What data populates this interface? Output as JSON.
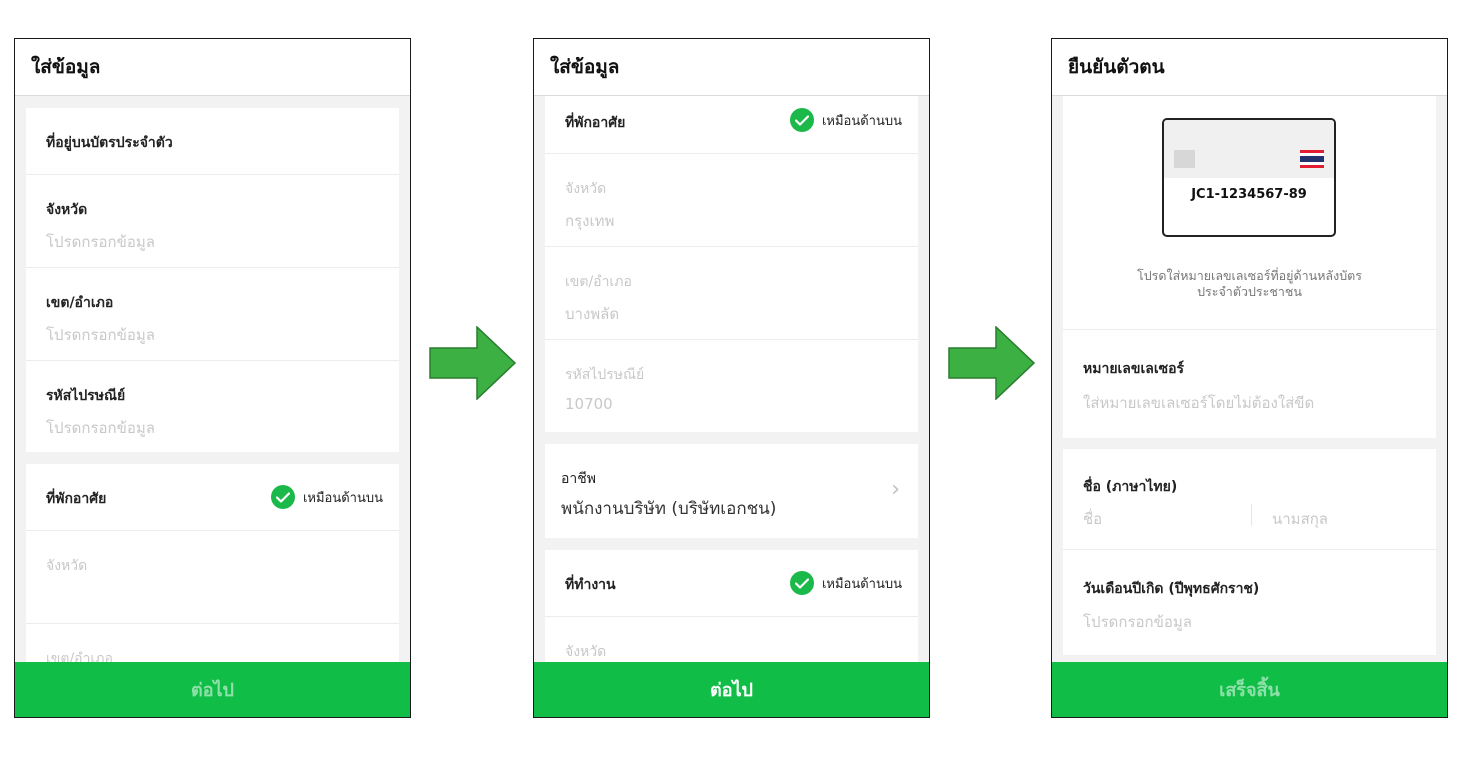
{
  "screen1": {
    "title": "ใส่ข้อมูล",
    "section_address": "ที่อยู่บนบัตรประจำตัว",
    "province_label": "จังหวัด",
    "province_placeholder": "โปรดกรอกข้อมูล",
    "district_label": "เขต/อำเภอ",
    "district_placeholder": "โปรดกรอกข้อมูล",
    "postal_label": "รหัสไปรษณีย์",
    "postal_placeholder": "โปรดกรอกข้อมูล",
    "residence_label": "ที่พักอาศัย",
    "same_as_above": "เหมือนด้านบน",
    "residence_province_label": "จังหวัด",
    "residence_district_label": "เขต/อำเภอ",
    "next_button": "ต่อไป"
  },
  "screen2": {
    "title": "ใส่ข้อมูล",
    "residence_label": "ที่พักอาศัย",
    "same_as_above": "เหมือนด้านบน",
    "province_label": "จังหวัด",
    "province_value": "กรุงเทพ",
    "district_label": "เขต/อำเภอ",
    "district_value": "บางพลัด",
    "postal_label": "รหัสไปรษณีย์",
    "postal_value": "10700",
    "occupation_label": "อาชีพ",
    "occupation_value": "พนักงานบริษัท (บริษัทเอกชน)",
    "workplace_label": "ที่ทำงาน",
    "workplace_same": "เหมือนด้านบน",
    "workplace_province_label": "จังหวัด",
    "next_button": "ต่อไป"
  },
  "screen3": {
    "title": "ยืนยันตัวตน",
    "card_number": "JC1-1234567-89",
    "instruction_line1": "โปรดใส่หมายเลขเลเซอร์ที่อยู่ด้านหลังบัตร",
    "instruction_line2": "ประจำตัวประชาชน",
    "laser_label": "หมายเลขเลเซอร์",
    "laser_placeholder": "ใส่หมายเลขเลเซอร์โดยไม่ต้องใส่ขีด",
    "name_label": "ชื่อ (ภาษาไทย)",
    "first_name_placeholder": "ชื่อ",
    "last_name_placeholder": "นามสกุล",
    "birthdate_label": "วันเดือนปีเกิด (ปีพุทธศักราช)",
    "birthdate_placeholder": "โปรดกรอกข้อมูล",
    "finish_button": "เสร็จสิ้น"
  },
  "colors": {
    "primary_green": "#10be47",
    "check_green": "#1ab94a",
    "arrow_green": "#3cb043"
  },
  "icons": [
    "check-circle-icon",
    "chevron-right-icon",
    "right-arrow-icon",
    "thai-flag-icon"
  ]
}
